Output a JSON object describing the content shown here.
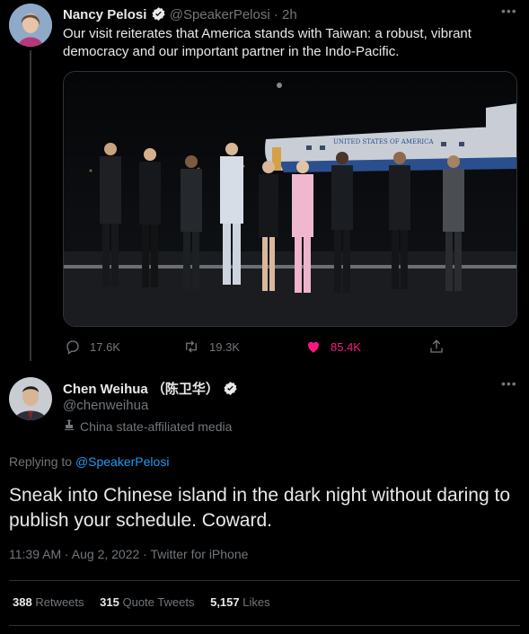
{
  "tweet1": {
    "author_name": "Nancy Pelosi",
    "handle": "@SpeakerPelosi",
    "separator": "·",
    "time": "2h",
    "text": "Our visit reiterates that America stands with Taiwan: a robust, vibrant democracy and our important partner in the Indo-Pacific.",
    "stats": {
      "replies": "17.6K",
      "retweets": "19.3K",
      "likes": "85.4K"
    },
    "like_color": "#f91880",
    "plane_text": "UNITED STATES OF AMERICA"
  },
  "tweet2": {
    "author_name": "Chen Weihua",
    "author_cn": "（陈卫华）",
    "handle": "@chenweihua",
    "affiliation": "China state-affiliated media",
    "replying_prefix": "Replying to",
    "replying_to": "@SpeakerPelosi",
    "text": "Sneak into Chinese island in the dark night without daring to publish your schedule. Coward.",
    "timestamp": "11:39 AM · Aug 2, 2022 · Twitter for iPhone",
    "retweets_count": "388",
    "retweets_label": "Retweets",
    "quote_count": "315",
    "quote_label": "Quote Tweets",
    "likes_count": "5,157",
    "likes_label": "Likes"
  },
  "colors": {
    "background": "#000000",
    "accent": "#1d9bf0",
    "muted": "#71767b",
    "verified": "#e7e9ea"
  }
}
